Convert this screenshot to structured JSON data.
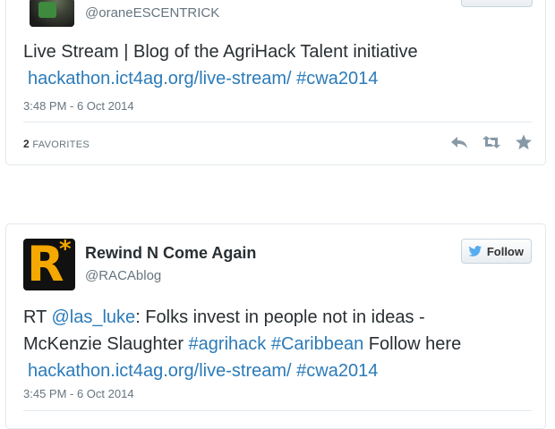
{
  "tweets": [
    {
      "handle": "@oraneESCENTRICK",
      "text_line1": "Live Stream | Blog of the AgriHack Talent initiative",
      "link": "hackathon.ict4ag.org/live-stream/",
      "hashtag": "#cwa2014",
      "timestamp": "3:48 PM - 6 Oct 2014",
      "favorites_count": "2",
      "favorites_label": "FAVORITES"
    },
    {
      "name": "Rewind N Come Again",
      "handle": "@RACAblog",
      "follow_label": "Follow",
      "avatar_letter": "R",
      "avatar_star": "*",
      "text_prefix": "RT ",
      "mention": "@las_luke",
      "text_mid": ": Folks invest in people not in ideas -",
      "text_line2": "McKenzie Slaughter ",
      "hashtag1": "#agrihack",
      "hashtag2": "#Caribbean",
      "text_follow": " Follow here",
      "link": "hackathon.ict4ag.org/live-stream/",
      "hashtag3": "#cwa2014",
      "timestamp": "3:45 PM - 6 Oct 2014"
    }
  ],
  "icons": {
    "reply": "reply-icon",
    "retweet": "retweet-icon",
    "favorite": "star-icon",
    "bird": "twitter-bird-icon"
  },
  "colors": {
    "link": "#2b7bb9",
    "muted": "#66757f",
    "text": "#292f33",
    "border": "#e1e8ed",
    "icon": "#8899a6",
    "twitter_blue": "#55acee",
    "avatar_accent": "#f5a800"
  }
}
